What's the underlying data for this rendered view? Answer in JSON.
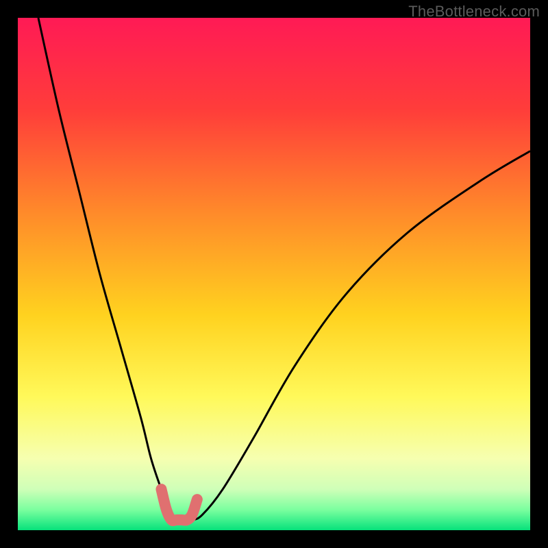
{
  "watermark": "TheBottleneck.com",
  "chart_data": {
    "type": "line",
    "title": "",
    "xlabel": "",
    "ylabel": "",
    "xlim": [
      0,
      100
    ],
    "ylim": [
      0,
      100
    ],
    "gradient_stops": [
      {
        "offset": 0,
        "color": "#ff1a55"
      },
      {
        "offset": 18,
        "color": "#ff3d3a"
      },
      {
        "offset": 38,
        "color": "#ff8a2a"
      },
      {
        "offset": 58,
        "color": "#ffd21f"
      },
      {
        "offset": 74,
        "color": "#fff95a"
      },
      {
        "offset": 86,
        "color": "#f6ffb0"
      },
      {
        "offset": 92,
        "color": "#cfffb8"
      },
      {
        "offset": 96,
        "color": "#7bff9f"
      },
      {
        "offset": 100,
        "color": "#06e27b"
      }
    ],
    "series": [
      {
        "name": "bottleneck-curve",
        "stroke": "#000000",
        "x": [
          4,
          8,
          12,
          16,
          20,
          24,
          26,
          28,
          30,
          32,
          34,
          36,
          40,
          46,
          54,
          64,
          76,
          90,
          100
        ],
        "y": [
          100,
          82,
          66,
          50,
          36,
          22,
          14,
          8,
          3,
          2,
          2,
          3,
          8,
          18,
          32,
          46,
          58,
          68,
          74
        ]
      },
      {
        "name": "highlight-segment",
        "stroke": "#e07070",
        "x": [
          28,
          29,
          30,
          31,
          32,
          33,
          34,
          35
        ],
        "y": [
          8,
          4,
          2,
          2,
          2,
          2,
          3,
          6
        ]
      }
    ]
  }
}
